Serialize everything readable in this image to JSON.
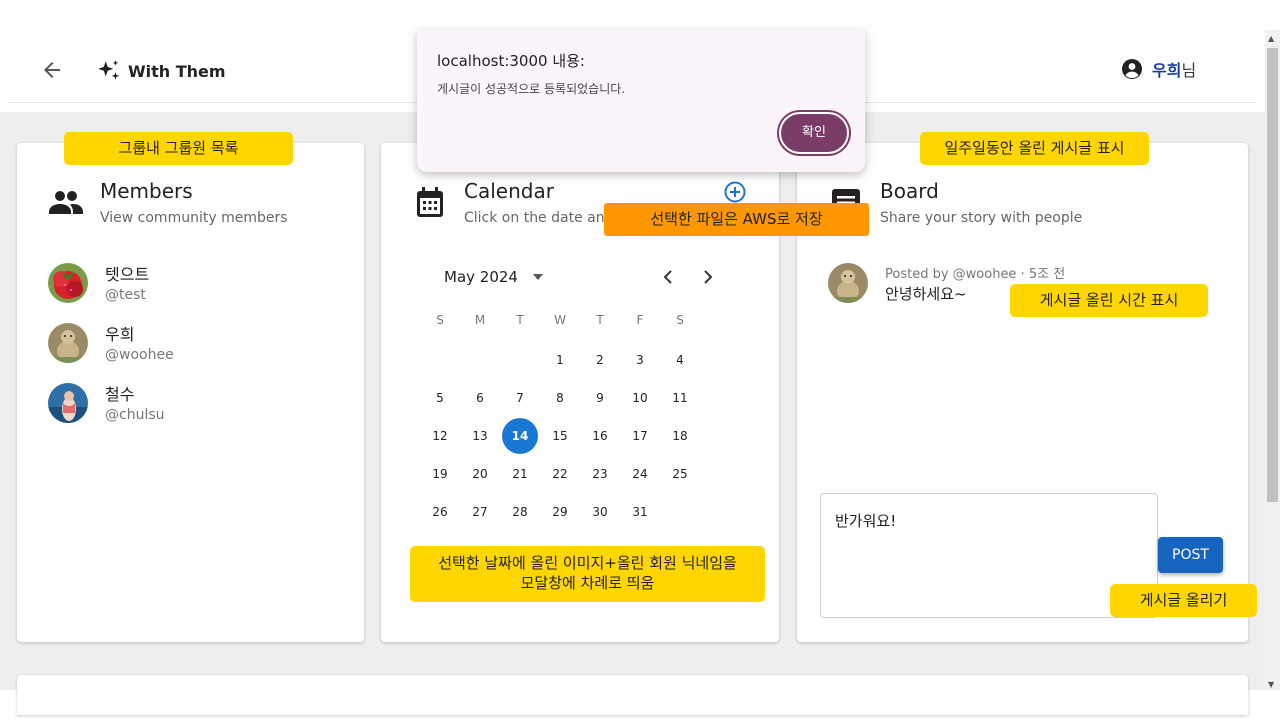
{
  "header": {
    "brand": "With Them",
    "user_name": "우희",
    "user_suffix": "님"
  },
  "dialog": {
    "title": "localhost:3000 내용:",
    "message": "게시글이 성공적으로 등록되었습니다.",
    "ok_label": "확인"
  },
  "members_card": {
    "title": "Members",
    "subtitle": "View community members",
    "members": [
      {
        "name": "텟으트",
        "handle": "@test"
      },
      {
        "name": "우희",
        "handle": "@woohee"
      },
      {
        "name": "철수",
        "handle": "@chulsu"
      }
    ]
  },
  "calendar_card": {
    "title": "Calendar",
    "subtitle": "Click on the date and s",
    "month_label": "May 2024",
    "weekdays": [
      "S",
      "M",
      "T",
      "W",
      "T",
      "F",
      "S"
    ],
    "selected_day": "14",
    "days": [
      "1",
      "2",
      "3",
      "4",
      "5",
      "6",
      "7",
      "8",
      "9",
      "10",
      "11",
      "12",
      "13",
      "14",
      "15",
      "16",
      "17",
      "18",
      "19",
      "20",
      "21",
      "22",
      "23",
      "24",
      "25",
      "26",
      "27",
      "28",
      "29",
      "30",
      "31"
    ]
  },
  "board_card": {
    "title": "Board",
    "subtitle": "Share your story with people",
    "post_meta": "Posted by @woohee · 5조 전",
    "post_text": "안녕하세요~",
    "input_value": "반가워요!",
    "post_button": "POST"
  },
  "annotations": {
    "members": "그룹내 그룹원 목록",
    "aws": "선택한 파일은 AWS로 저장",
    "board": "일주일동안 올린 게시글 표시",
    "post_time": "게시글 올린 시간 표시",
    "calendar_line1": "선택한 날짜에 올린 이미지+올린 회원 닉네임을",
    "calendar_line2": "모달창에 차례로 띄움",
    "post_upload": "게시글 올리기"
  },
  "colors": {
    "accent": "#1976d2",
    "annotation": "#ffd600",
    "annotation_alt": "#ff9800",
    "dialog_button": "#7b3d68"
  }
}
